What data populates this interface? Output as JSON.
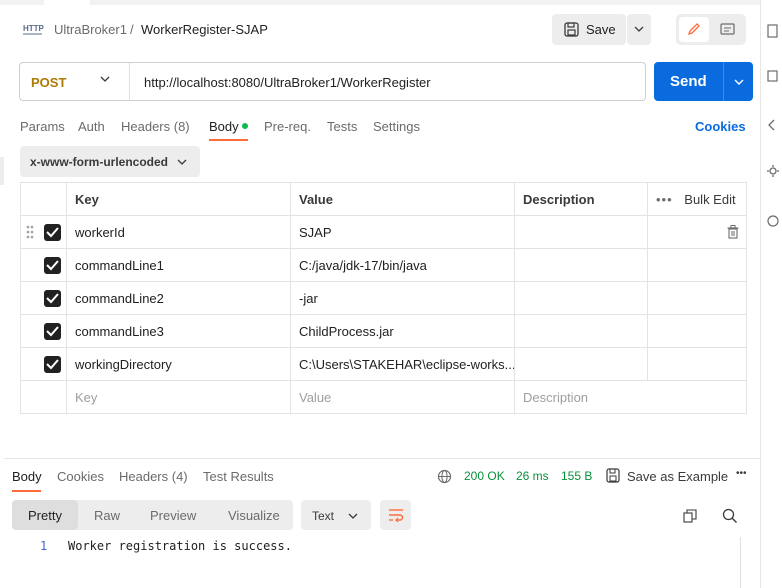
{
  "breadcrumb": {
    "parent": "UltraBroker1",
    "separator": "/",
    "current": "WorkerRegister-SJAP",
    "icon": "http-icon"
  },
  "toolbar": {
    "save_label": "Save"
  },
  "request": {
    "method": "POST",
    "url": "http://localhost:8080/UltraBroker1/WorkerRegister",
    "send_label": "Send"
  },
  "request_tabs": [
    {
      "label": "Params"
    },
    {
      "label": "Auth"
    },
    {
      "label": "Headers (8)"
    },
    {
      "label": "Body",
      "active": true
    },
    {
      "label": "Pre-req."
    },
    {
      "label": "Tests"
    },
    {
      "label": "Settings"
    }
  ],
  "cookies_label": "Cookies",
  "body_type": "x-www-form-urlencoded",
  "params_table": {
    "headers": {
      "key": "Key",
      "value": "Value",
      "description": "Description",
      "bulk_edit": "Bulk Edit"
    },
    "rows": [
      {
        "key": "workerId",
        "value": "SJAP",
        "checked": true
      },
      {
        "key": "commandLine1",
        "value": "C:/java/jdk-17/bin/java",
        "checked": true
      },
      {
        "key": "commandLine2",
        "value": "-jar",
        "checked": true
      },
      {
        "key": "commandLine3",
        "value": "ChildProcess.jar",
        "checked": true
      },
      {
        "key": "workingDirectory",
        "value": "C:\\Users\\STAKEHAR\\eclipse-works...",
        "checked": true
      }
    ],
    "placeholder": {
      "key": "Key",
      "value": "Value",
      "description": "Description"
    }
  },
  "response": {
    "tabs": [
      {
        "label": "Body",
        "active": true
      },
      {
        "label": "Cookies"
      },
      {
        "label": "Headers (4)"
      },
      {
        "label": "Test Results"
      }
    ],
    "status": "200 OK",
    "time": "26 ms",
    "size": "155 B",
    "save_example": "Save as Example",
    "view_tabs": [
      {
        "label": "Pretty",
        "active": true
      },
      {
        "label": "Raw"
      },
      {
        "label": "Preview"
      },
      {
        "label": "Visualize"
      }
    ],
    "format": "Text",
    "lines": [
      {
        "number": "1",
        "text": "Worker registration is success."
      }
    ]
  },
  "colors": {
    "accent": "#ff6c37",
    "send": "#0a6bde",
    "method": "#ad7a03",
    "status_ok": "#0a8f3c",
    "body_dot": "#0cbb52"
  }
}
